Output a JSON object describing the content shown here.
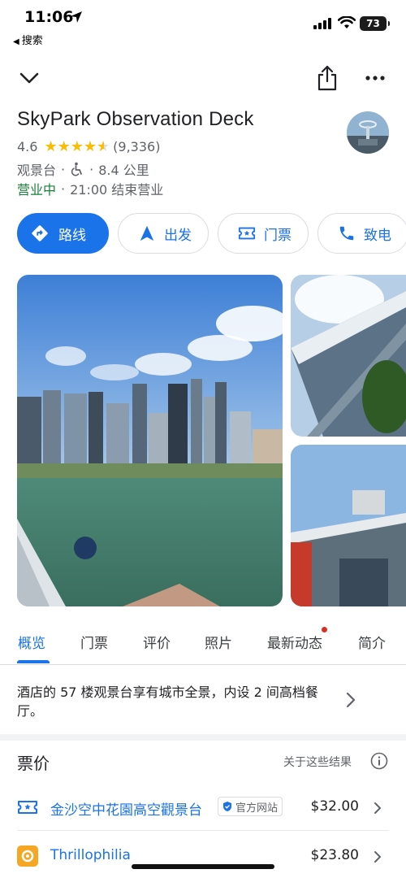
{
  "status_bar": {
    "time": "11:06",
    "back_label": "搜索",
    "battery": "73"
  },
  "place": {
    "name": "SkyPark Observation Deck",
    "rating": "4.6",
    "stars": 4.5,
    "review_count": "(9,336)",
    "category": "观景台",
    "distance": "8.4 公里",
    "open_status": "营业中",
    "closing": "21:00 结束营业"
  },
  "actions": [
    {
      "label": "路线",
      "icon": "directions-icon"
    },
    {
      "label": "出发",
      "icon": "navigation-arrow-icon"
    },
    {
      "label": "门票",
      "icon": "ticket-icon"
    },
    {
      "label": "致电",
      "icon": "phone-icon"
    }
  ],
  "tabs": [
    "概览",
    "门票",
    "评价",
    "照片",
    "最新动态",
    "简介"
  ],
  "description": "酒店的 57 楼观景台享有城市全景，内设 2 间高档餐厅。",
  "tickets": {
    "title": "票价",
    "about": "关于这些结果",
    "rows": [
      {
        "name": "金沙空中花園高空觀景台",
        "badge": "官方网站",
        "price": "$32.00"
      },
      {
        "name": "Thrillophilia",
        "badge": "",
        "price": "$23.80"
      }
    ]
  },
  "colors": {
    "accent": "#1a73e8",
    "open_green": "#188038",
    "star": "#fbbc04",
    "thrillophilia": "#f5a623"
  }
}
